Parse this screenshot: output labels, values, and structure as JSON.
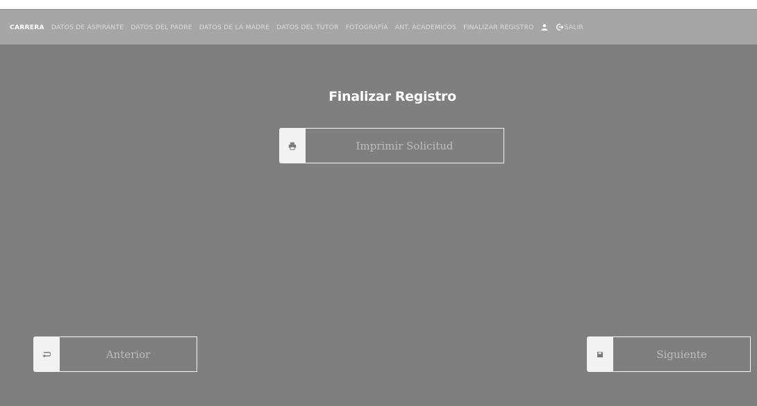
{
  "nav": {
    "items": [
      {
        "label": "CARRERA",
        "active": true
      },
      {
        "label": "DATOS DE ASPIRANTE",
        "active": false
      },
      {
        "label": "DATOS DEL PADRE",
        "active": false
      },
      {
        "label": "DATOS DE LA MADRE",
        "active": false
      },
      {
        "label": "DATOS DEL TUTOR",
        "active": false
      },
      {
        "label": "FOTOGRAFÍA",
        "active": false
      },
      {
        "label": "ANT. ACADEMICOS",
        "active": false
      },
      {
        "label": "FINALIZAR REGISTRO",
        "active": false
      }
    ],
    "user_icon": "user-icon",
    "logout_icon": "logout-icon",
    "logout_label": "SALIR"
  },
  "page": {
    "title": "Finalizar Registro"
  },
  "buttons": {
    "print": {
      "label": "Imprimir Solicitud",
      "icon": "print-icon"
    },
    "previous": {
      "label": "Anterior",
      "icon": "back-icon"
    },
    "next": {
      "label": "Siguiente",
      "icon": "save-icon"
    }
  },
  "colors": {
    "background": "#7f7f7f",
    "navbar": "#a6a6a6",
    "nav_text": "#dcdcdc",
    "active_text": "#ffffff",
    "button_icon_bg": "#f2f2f2",
    "button_text": "#bdbdbd"
  }
}
